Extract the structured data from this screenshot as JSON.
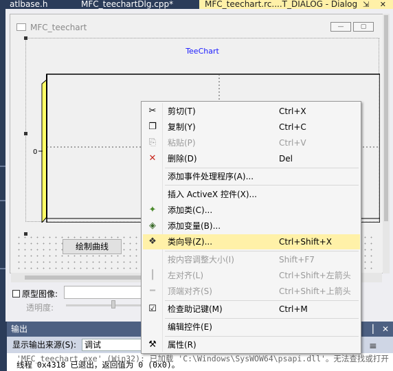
{
  "tabs": [
    {
      "label": "atlbase.h"
    },
    {
      "label": "MFC_teechartDlg.cpp*"
    },
    {
      "label": "MFC_teechart.rc....T_DIALOG - Dialog",
      "active": true
    }
  ],
  "tab_icons": "⇲ ✕",
  "dialog": {
    "title": "MFC_teechart",
    "min_glyph": "—",
    "max_glyph": "▢"
  },
  "chart": {
    "title": "TeeChart",
    "y_tick": "0",
    "panel_color": "#ffff66",
    "frame_color": "#000000"
  },
  "draw_button": "绘制曲线",
  "controls": {
    "checkbox_label": "原型图像:",
    "opacity_label": "透明度:"
  },
  "output": {
    "title": "输出",
    "pin": "▕",
    "close": "✕",
    "source_label": "显示输出来源(S):",
    "source_value": "调试",
    "line1": "     'MFC_teechart.exe' (Win32): 已加载 'C:\\Windows\\SysWOW64\\psapi.dll'。无法查找或打开 PD",
    "line2": "线程 0x4318 已退出，返回值为 0 (0x0)。",
    "icons": "≡"
  },
  "menu": {
    "highlight_color": "#fff1a8",
    "items": [
      {
        "icon": "cut-icon",
        "glyph": "✂",
        "label": "剪切(T)",
        "shortcut": "Ctrl+X",
        "disabled": false
      },
      {
        "icon": "copy-icon",
        "glyph": "❐",
        "label": "复制(Y)",
        "shortcut": "Ctrl+C",
        "disabled": false
      },
      {
        "icon": "paste-icon",
        "glyph": "⎘",
        "label": "粘贴(P)",
        "shortcut": "Ctrl+V",
        "disabled": true
      },
      {
        "icon": "delete-icon",
        "glyph": "✕",
        "label": "删除(D)",
        "shortcut": "Del",
        "disabled": false
      },
      {
        "icon": "",
        "glyph": "",
        "label": "添加事件处理程序(A)...",
        "shortcut": "",
        "disabled": false
      },
      {
        "icon": "",
        "glyph": "",
        "label": "插入 ActiveX 控件(X)...",
        "shortcut": "",
        "disabled": false
      },
      {
        "icon": "add-class-icon",
        "glyph": "✦",
        "label": "添加类(C)...",
        "shortcut": "",
        "disabled": false
      },
      {
        "icon": "add-variable-icon",
        "glyph": "◈",
        "label": "添加变量(B)...",
        "shortcut": "",
        "disabled": false
      },
      {
        "icon": "class-wizard-icon",
        "glyph": "❖",
        "label": "类向导(Z)...",
        "shortcut": "Ctrl+Shift+X",
        "disabled": false,
        "highlighted": true
      },
      {
        "icon": "",
        "glyph": "",
        "label": "按内容调整大小(I)",
        "shortcut": "Shift+F7",
        "disabled": true
      },
      {
        "icon": "align-left-icon",
        "glyph": "┃",
        "label": "左对齐(L)",
        "shortcut": "Ctrl+Shift+左箭头",
        "disabled": true
      },
      {
        "icon": "align-top-icon",
        "glyph": "━",
        "label": "顶端对齐(S)",
        "shortcut": "Ctrl+Shift+上箭头",
        "disabled": true
      },
      {
        "icon": "check-mnemonics-icon",
        "glyph": "☑",
        "label": "检查助记键(M)",
        "shortcut": "Ctrl+M",
        "disabled": false
      },
      {
        "icon": "",
        "glyph": "",
        "label": "编辑控件(E)",
        "shortcut": "",
        "disabled": false
      },
      {
        "icon": "properties-icon",
        "glyph": "⚒",
        "label": "属性(R)",
        "shortcut": "",
        "disabled": false
      }
    ]
  }
}
